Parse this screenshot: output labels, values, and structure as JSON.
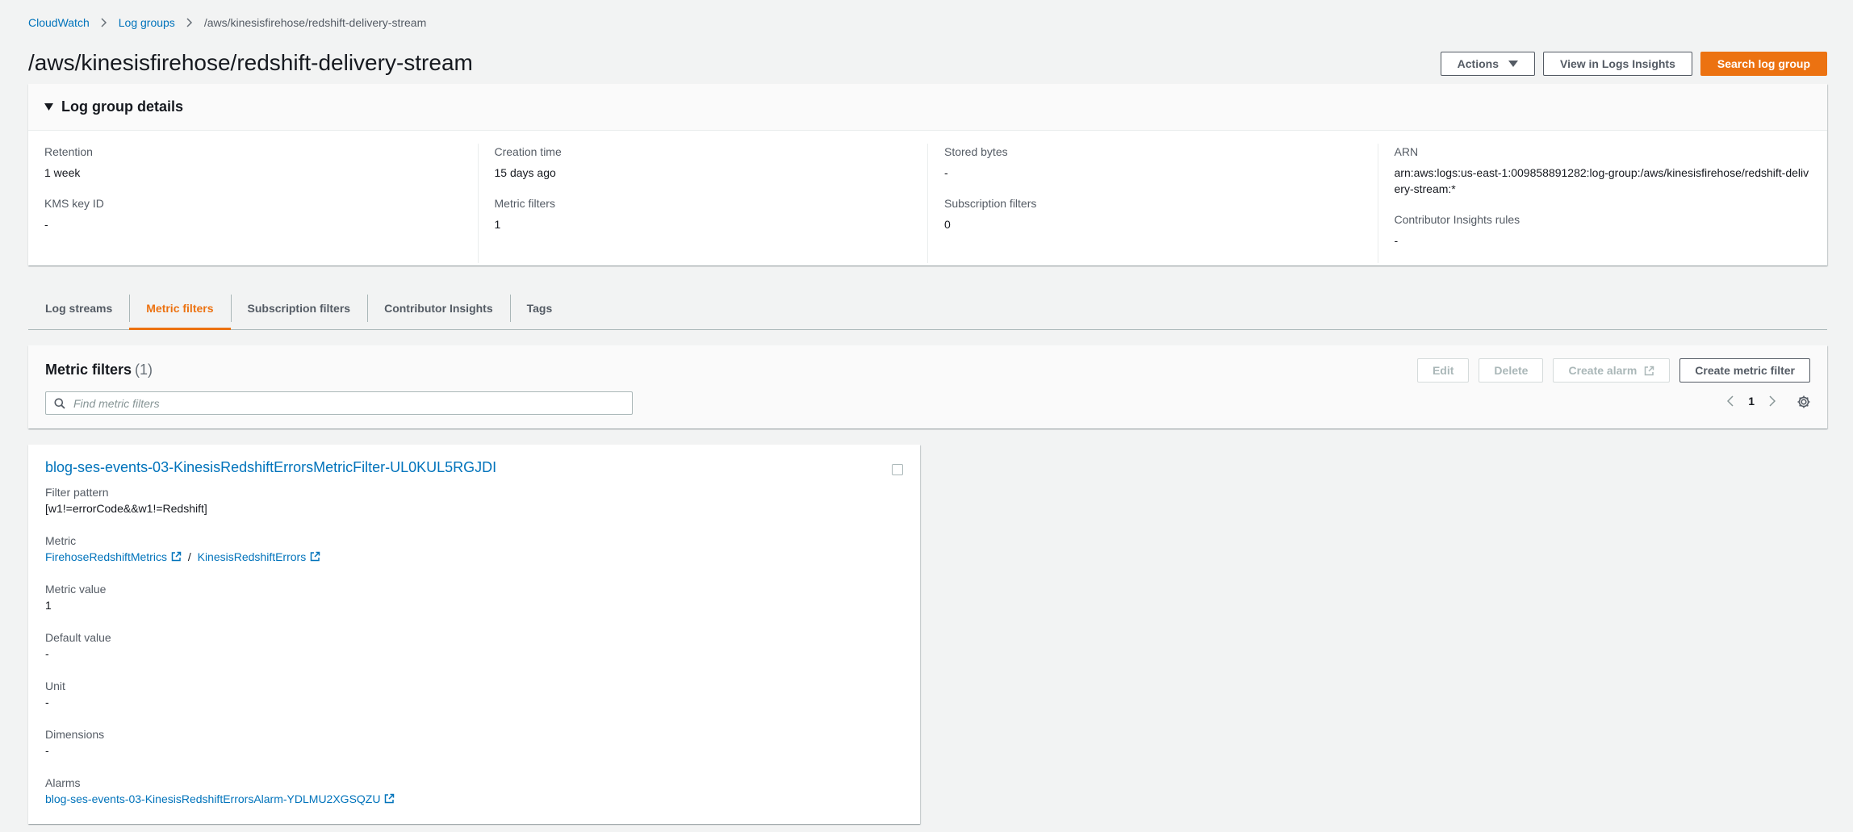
{
  "breadcrumb": {
    "items": [
      "CloudWatch",
      "Log groups"
    ],
    "current": "/aws/kinesisfirehose/redshift-delivery-stream"
  },
  "page": {
    "title": "/aws/kinesisfirehose/redshift-delivery-stream",
    "actions_label": "Actions",
    "view_insights_label": "View in Logs Insights",
    "search_label": "Search log group"
  },
  "details": {
    "heading": "Log group details",
    "retention_label": "Retention",
    "retention_value": "1 week",
    "kms_label": "KMS key ID",
    "kms_value": "-",
    "creation_label": "Creation time",
    "creation_value": "15 days ago",
    "metric_filters_label": "Metric filters",
    "metric_filters_value": "1",
    "stored_label": "Stored bytes",
    "stored_value": "-",
    "subscription_label": "Subscription filters",
    "subscription_value": "0",
    "arn_label": "ARN",
    "arn_value": "arn:aws:logs:us-east-1:009858891282:log-group:/aws/kinesisfirehose/redshift-delivery-stream:*",
    "contrib_label": "Contributor Insights rules",
    "contrib_value": "-"
  },
  "tabs": [
    "Log streams",
    "Metric filters",
    "Subscription filters",
    "Contributor Insights",
    "Tags"
  ],
  "metric_filters": {
    "title": "Metric filters",
    "count": "(1)",
    "edit_label": "Edit",
    "delete_label": "Delete",
    "create_alarm_label": "Create alarm",
    "create_filter_label": "Create metric filter",
    "search_placeholder": "Find metric filters",
    "page": "1"
  },
  "card": {
    "name": "blog-ses-events-03-KinesisRedshiftErrorsMetricFilter-UL0KUL5RGJDI",
    "filter_pattern_label": "Filter pattern",
    "filter_pattern_value": "[w1!=errorCode&&w1!=Redshift]",
    "metric_label": "Metric",
    "metric_namespace": "FirehoseRedshiftMetrics",
    "metric_sep": "/",
    "metric_name": "KinesisRedshiftErrors",
    "metric_value_label": "Metric value",
    "metric_value": "1",
    "default_label": "Default value",
    "default_value": "-",
    "unit_label": "Unit",
    "unit_value": "-",
    "dimensions_label": "Dimensions",
    "dimensions_value": "-",
    "alarms_label": "Alarms",
    "alarm_name": "blog-ses-events-03-KinesisRedshiftErrorsAlarm-YDLMU2XGSQZU"
  },
  "colors": {
    "accent": "#ec7211",
    "link": "#0073bb",
    "background": "#f2f3f3"
  },
  "icons": [
    "chevron-right-icon",
    "caret-down-icon",
    "triangle-down-icon",
    "search-icon",
    "chevron-left-icon",
    "gear-icon",
    "external-link-icon"
  ]
}
